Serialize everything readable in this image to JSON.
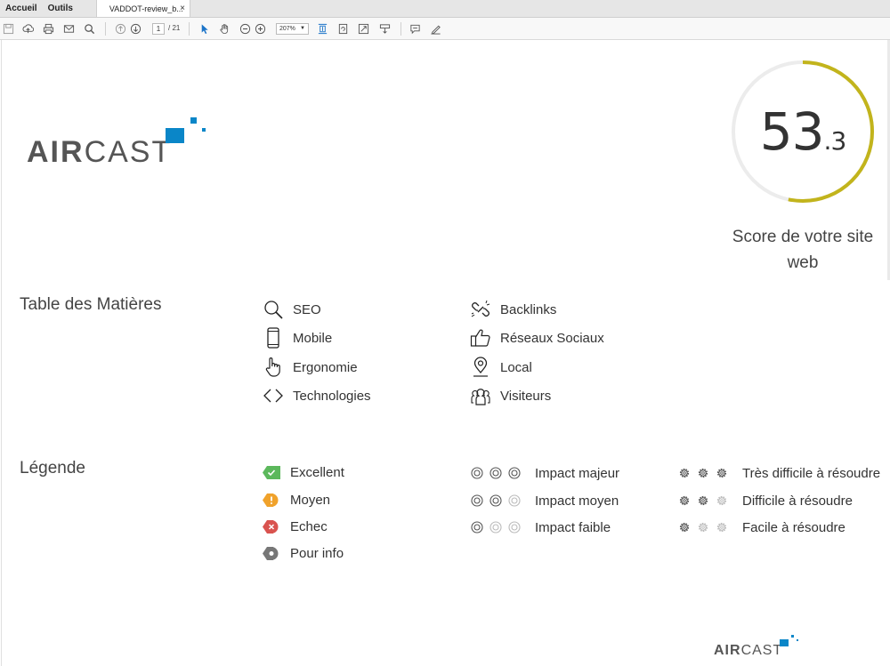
{
  "app": {
    "nav_tabs": [
      "Accueil",
      "Outils"
    ],
    "document_tab": "VADDOT-review_b...",
    "close_glyph": "×"
  },
  "toolbar": {
    "page_current": "1",
    "page_total": "/ 21",
    "zoom": "207%"
  },
  "report": {
    "brand_bold": "AIR",
    "brand_light": "CAST",
    "score_int": "53",
    "score_dec": ".3",
    "score_fraction": 0.533,
    "score_caption_line1": "Score de votre site",
    "score_caption_line2": "web",
    "colors": {
      "accent": "#0a86c8",
      "score_ring": "#c2b41c",
      "ring_track": "#ececec",
      "excellent": "#5cb85c",
      "moyen": "#f0a22b",
      "echec": "#d9534f",
      "info": "#777777"
    }
  },
  "toc": {
    "title": "Table des Matières",
    "items": [
      {
        "label": "SEO",
        "icon": "magnifier-icon"
      },
      {
        "label": "Mobile",
        "icon": "mobile-phone-icon"
      },
      {
        "label": "Ergonomie",
        "icon": "pointer-hand-icon"
      },
      {
        "label": "Technologies",
        "icon": "code-brackets-icon"
      },
      {
        "label": "Backlinks",
        "icon": "broken-link-icon"
      },
      {
        "label": "Réseaux Sociaux",
        "icon": "thumbs-up-icon"
      },
      {
        "label": "Local",
        "icon": "map-pin-icon"
      },
      {
        "label": "Visiteurs",
        "icon": "users-icon"
      }
    ]
  },
  "legend": {
    "title": "Légende",
    "status": [
      {
        "label": "Excellent",
        "icon": "check-badge-icon"
      },
      {
        "label": "Moyen",
        "icon": "exclamation-badge-icon"
      },
      {
        "label": "Echec",
        "icon": "cross-badge-icon"
      },
      {
        "label": "Pour info",
        "icon": "dot-badge-icon"
      }
    ],
    "impact": [
      {
        "label": "Impact majeur",
        "level": 3
      },
      {
        "label": "Impact moyen",
        "level": 2
      },
      {
        "label": "Impact faible",
        "level": 1
      }
    ],
    "difficulty": [
      {
        "label": "Très difficile à résoudre",
        "level": 3
      },
      {
        "label": "Difficile à résoudre",
        "level": 2
      },
      {
        "label": "Facile à résoudre",
        "level": 1
      }
    ]
  }
}
